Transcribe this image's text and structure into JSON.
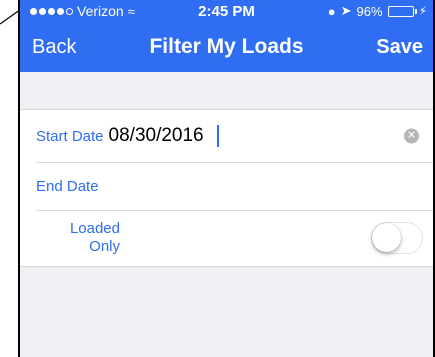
{
  "status_bar": {
    "carrier": "Verizon",
    "wifi_icon": "wifi-icon",
    "time": "2:45 PM",
    "battery_percent": "96%",
    "battery_level": 0.96
  },
  "nav": {
    "back_label": "Back",
    "title": "Filter My Loads",
    "save_label": "Save"
  },
  "form": {
    "start_date_label": "Start Date",
    "start_date_value": "08/30/2016",
    "end_date_label": "End Date",
    "end_date_value": "",
    "loaded_only_label_line1": "Loaded",
    "loaded_only_label_line2": "Only",
    "loaded_only_on": false
  },
  "colors": {
    "accent": "#2f6ef2",
    "background": "#efeff4",
    "battery": "#4cd964"
  }
}
